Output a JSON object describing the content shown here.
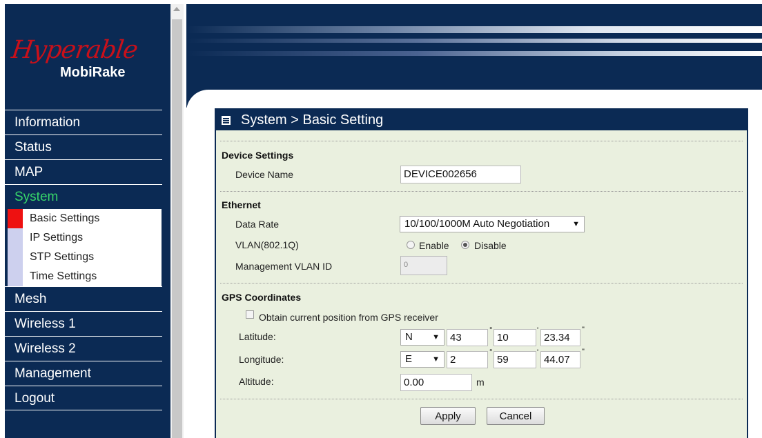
{
  "brand": {
    "logo_script": "Hyperable",
    "product": "MobiRake",
    "brand_color": "#c8101a"
  },
  "nav": {
    "items": [
      {
        "label": "Information"
      },
      {
        "label": "Status"
      },
      {
        "label": "MAP"
      },
      {
        "label": "System",
        "active": true
      }
    ],
    "sub_items": [
      {
        "label": "Basic Settings",
        "active": true
      },
      {
        "label": "IP Settings"
      },
      {
        "label": "STP Settings"
      },
      {
        "label": "Time Settings"
      }
    ],
    "items_after": [
      {
        "label": "Mesh"
      },
      {
        "label": "Wireless 1"
      },
      {
        "label": "Wireless 2"
      },
      {
        "label": "Management"
      },
      {
        "label": "Logout"
      }
    ],
    "active_color": "#37d66a"
  },
  "panel": {
    "title": "System > Basic Setting",
    "device": {
      "section": "Device Settings",
      "name_label": "Device Name",
      "name_value": "DEVICE002656"
    },
    "ethernet": {
      "section": "Ethernet",
      "data_rate_label": "Data Rate",
      "data_rate_value": "10/100/1000M Auto Negotiation",
      "vlan_label": "VLAN(802.1Q)",
      "enable_label": "Enable",
      "disable_label": "Disable",
      "vlan_selected": "Disable",
      "mgmt_vlan_label": "Management VLAN ID",
      "mgmt_vlan_value": "0"
    },
    "gps": {
      "section": "GPS Coordinates",
      "obtain_label": "Obtain current position from GPS receiver",
      "obtain_checked": false,
      "latitude_label": "Latitude:",
      "lat_dir": "N",
      "lat_deg": "43",
      "lat_min": "10",
      "lat_sec": "23.34",
      "longitude_label": "Longitude:",
      "lon_dir": "E",
      "lon_deg": "2",
      "lon_min": "59",
      "lon_sec": "44.07",
      "altitude_label": "Altitude:",
      "altitude_value": "0.00",
      "altitude_unit": "m",
      "deg_symbol": "°",
      "min_symbol": "'",
      "sec_symbol": "\""
    },
    "buttons": {
      "apply": "Apply",
      "cancel": "Cancel"
    }
  },
  "colors": {
    "navy": "#0b2a54",
    "panel_bg": "#eaf0df",
    "sub_marker": "#cdd0ee",
    "active_marker": "#ee1111"
  }
}
